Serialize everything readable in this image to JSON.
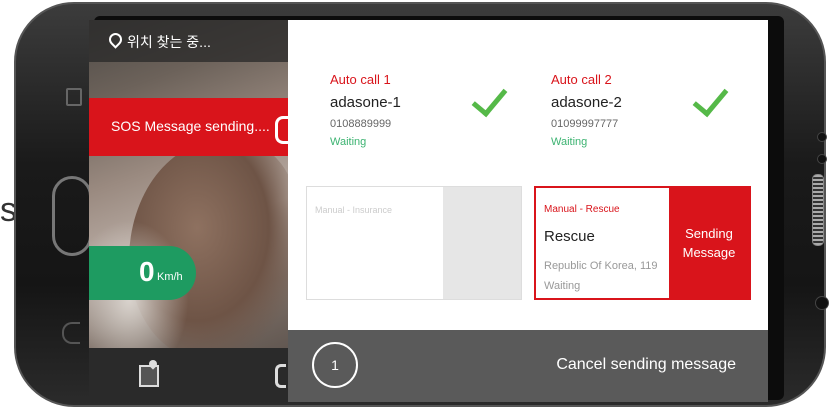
{
  "stray_text": "s",
  "status": {
    "location_text": "위치 찾는 중..."
  },
  "sos": {
    "text": "SOS Message sending...."
  },
  "speed": {
    "value": "0",
    "unit": "Km/h"
  },
  "auto_calls": [
    {
      "label": "Auto call 1",
      "name": "adasone-1",
      "number": "0108889999",
      "status": "Waiting"
    },
    {
      "label": "Auto call 2",
      "name": "adasone-2",
      "number": "01099997777",
      "status": "Waiting"
    }
  ],
  "manual_insurance": {
    "label": "Manual - Insurance"
  },
  "manual_rescue": {
    "label": "Manual - Rescue",
    "name": "Rescue",
    "location": "Republic Of Korea, 119",
    "status": "Waiting",
    "action": "Sending\nMessage"
  },
  "cancel": {
    "countdown": "1",
    "label": "Cancel sending message"
  },
  "colors": {
    "accent_red": "#d9141b",
    "speed_green": "#1e9b61",
    "check_green": "#55b948",
    "cancel_bar": "#5a5a5a"
  },
  "icons": [
    "location-pin-icon",
    "phone-icon",
    "map-icon",
    "check-icon",
    "recent-apps-icon",
    "back-icon"
  ]
}
